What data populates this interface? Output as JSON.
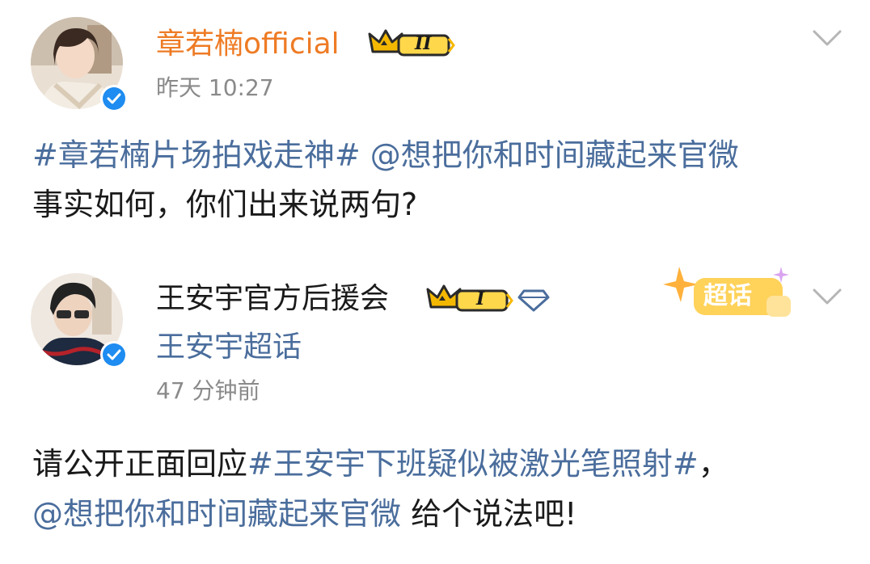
{
  "post1": {
    "author": "章若楠official",
    "level": "II",
    "time": "昨天 10:27",
    "hashtag": "#章若楠片场拍戏走神#",
    "mention": "@想把你和时间藏起来官微",
    "line2": "事实如何，你们出来说两句?"
  },
  "post2": {
    "author": "王安宇官方后援会",
    "level": "I",
    "supertopic": "王安宇超话",
    "time": "47 分钟前",
    "badge_label": "超话",
    "line1_prefix": "请公开正面回应",
    "hashtag": "#王安宇下班疑似被激光笔照射#",
    "line1_suffix": "，",
    "mention": "@想把你和时间藏起来官微",
    "line2_suffix": " 给个说法吧!"
  },
  "colors": {
    "brand_orange": "#ee7b24",
    "link_blue": "#4a6d9c",
    "meta_gray": "#8a8a8a",
    "verified_blue": "#1e8cf0",
    "crown_gold": "#f5b800"
  }
}
